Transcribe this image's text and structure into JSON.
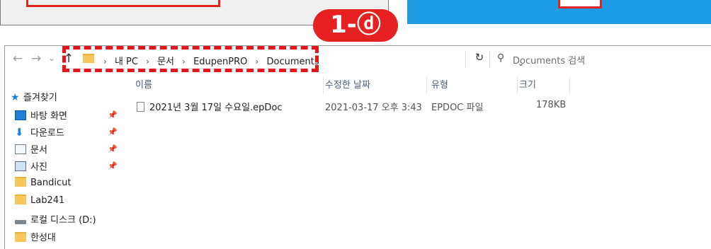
{
  "annotation": {
    "label": "1-ⓓ",
    "color": "#e62121"
  },
  "nav": {
    "back": "←",
    "forward": "→",
    "recent": "⌄",
    "up": "↑"
  },
  "address": {
    "crumbs": [
      "내 PC",
      "문서",
      "EdupenPRO",
      "Documents"
    ],
    "separator": "›",
    "dropdown": "⌄",
    "refresh": "↻"
  },
  "search": {
    "placeholder": "Documents 검색",
    "icon": "search-icon"
  },
  "sidebar": {
    "quick_access": "즐겨찾기",
    "items": [
      {
        "label": "바탕 화면",
        "icon": "desktop-icon",
        "pinned": true
      },
      {
        "label": "다운로드",
        "icon": "download-icon",
        "pinned": true
      },
      {
        "label": "문서",
        "icon": "documents-icon",
        "pinned": true
      },
      {
        "label": "사진",
        "icon": "pictures-icon",
        "pinned": true
      },
      {
        "label": "Bandicut",
        "icon": "folder-icon",
        "pinned": false
      },
      {
        "label": "Lab241",
        "icon": "folder-icon",
        "pinned": false
      },
      {
        "label": "로컬 디스크 (D:)",
        "icon": "drive-icon",
        "pinned": false
      },
      {
        "label": "한성대",
        "icon": "folder-icon",
        "pinned": false
      }
    ]
  },
  "columns": {
    "name": "이름",
    "modified": "수정한 날짜",
    "type": "유형",
    "size": "크기"
  },
  "files": [
    {
      "name": "2021년 3월 17일 수요일.epDoc",
      "modified": "2021-03-17 오후 3:43",
      "type": "EPDOC 파일",
      "size": "178KB"
    }
  ]
}
